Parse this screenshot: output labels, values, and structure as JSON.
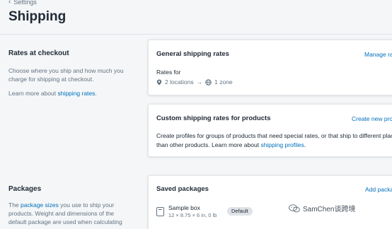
{
  "header": {
    "breadcrumb": "Settings",
    "title": "Shipping"
  },
  "rates_section": {
    "heading": "Rates at checkout",
    "description": "Choose where you ship and how much you charge for shipping at checkout.",
    "learn_prefix": "Learn more about ",
    "learn_link": "shipping rates",
    "learn_suffix": "."
  },
  "general_card": {
    "title": "General shipping rates",
    "action": "Manage rates",
    "rates_for": "Rates for",
    "locations": "2 locations",
    "arrow": "→",
    "zones": "1 zone"
  },
  "custom_card": {
    "title": "Custom shipping rates for products",
    "action": "Create new profile",
    "line1": "Create profiles for groups of products that need special rates, or that ship to different places,",
    "line2_prefix": "than other products. Learn more about ",
    "line2_link": "shipping profiles",
    "line2_suffix": "."
  },
  "packages_section": {
    "heading": "Packages",
    "desc_prefix": "The ",
    "desc_link": "package sizes",
    "desc_line1_suffix": " you use to ship your",
    "desc_line2": "products. Weight and dimensions of the",
    "desc_line3": "default package are used when calculating"
  },
  "saved_card": {
    "title": "Saved packages",
    "action": "Add package",
    "package_name": "Sample box",
    "package_dims": "12 × 8.75 × 6 in, 0 lb",
    "badge": "Default"
  },
  "watermark": {
    "text": "SamChen谈跨境"
  },
  "colors": {
    "link": "#006fbb",
    "background": "#f4f6f8",
    "text": "#212b36",
    "muted": "#637381"
  }
}
